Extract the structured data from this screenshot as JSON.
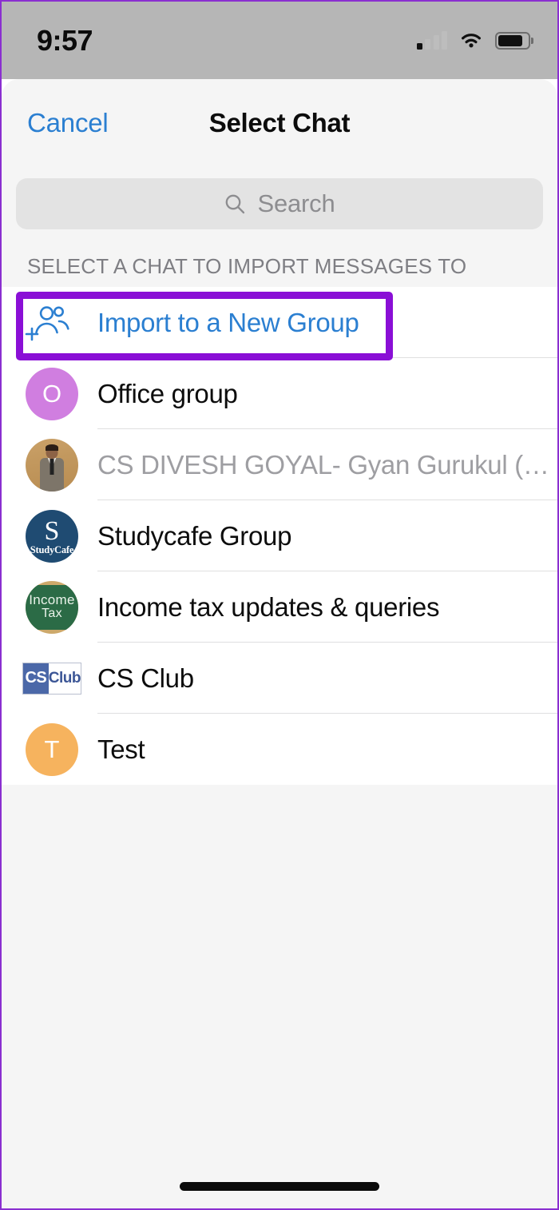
{
  "status_bar": {
    "time": "9:57",
    "cellular_icon": "cellular-signal-icon",
    "cellular_bars_active": 1,
    "cellular_bars_total": 4,
    "wifi_icon": "wifi-icon",
    "battery_icon": "battery-icon",
    "battery_level_percent": 84
  },
  "nav": {
    "cancel_label": "Cancel",
    "title": "Select Chat"
  },
  "search": {
    "placeholder": "Search",
    "value": "",
    "icon": "search-icon"
  },
  "section": {
    "header": "SELECT A CHAT TO IMPORT MESSAGES TO"
  },
  "colors": {
    "link_blue": "#2b7fd1",
    "annotation_purple": "#8a0fd6",
    "sheet_background": "#f5f5f5",
    "list_background": "#ffffff",
    "status_bar_background": "#b6b6b6",
    "search_field": "#e3e3e3",
    "muted_text": "#9e9ea2",
    "separator": "#dfdfe0"
  },
  "rows": [
    {
      "label": "Import to a New Group",
      "kind": "action",
      "icon": "add-people-icon",
      "highlighted": true
    },
    {
      "label": "Office group",
      "kind": "chat",
      "avatar_type": "initial",
      "avatar_initial": "O",
      "avatar_color": "#d07ee0"
    },
    {
      "label": "CS DIVESH GOYAL- Gyan Gurukul (R...",
      "kind": "chat",
      "muted": true,
      "avatar_type": "photo",
      "avatar_alt": "person-photo-avatar"
    },
    {
      "label": "Studycafe Group",
      "kind": "chat",
      "avatar_type": "logo-studycafe",
      "avatar_logo_main": "S",
      "avatar_logo_sub": "StudyCafe",
      "avatar_color": "#1f4b72"
    },
    {
      "label": "Income tax updates & queries",
      "kind": "chat",
      "avatar_type": "logo-incometax",
      "avatar_logo_line1": "Income",
      "avatar_logo_line2": "Tax",
      "avatar_color": "#2b6b46"
    },
    {
      "label": "CS Club",
      "kind": "chat",
      "avatar_type": "logo-csclub",
      "avatar_logo_left": "CS",
      "avatar_logo_right": "Club"
    },
    {
      "label": "Test",
      "kind": "chat",
      "avatar_type": "initial",
      "avatar_initial": "T",
      "avatar_color": "#f6b35e"
    }
  ],
  "home_indicator": "home-indicator"
}
